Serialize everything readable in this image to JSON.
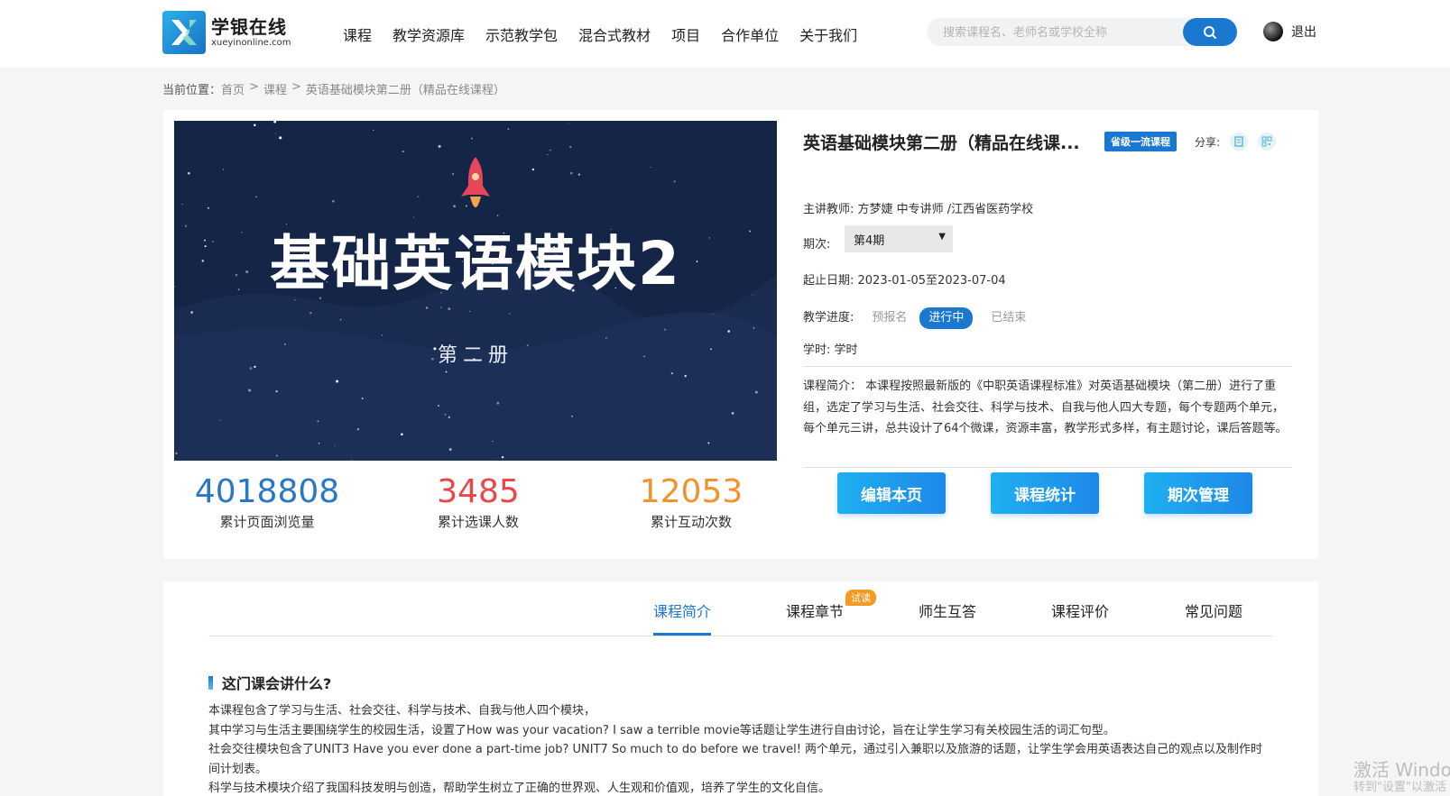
{
  "header": {
    "logo_cn": "学银在线",
    "logo_en": "xueyinonline.com",
    "nav": [
      "课程",
      "教学资源库",
      "示范教学包",
      "混合式教材",
      "项目",
      "合作单位",
      "关于我们"
    ],
    "search_placeholder": "搜索课程名、老师名或学校全称",
    "logout": "退出"
  },
  "breadcrumb": {
    "label": "当前位置：",
    "items": [
      "首页",
      "课程",
      "英语基础模块第二册（精品在线课程）"
    ],
    "separator": ">"
  },
  "course": {
    "cover_title": "基础英语模块2",
    "cover_subtitle": "第二册",
    "title": "英语基础模块第二册（精品在线课程）",
    "title_display": "英语基础模块第二册（精品在线课...",
    "badge": "省级一流课程",
    "share_label": "分享:",
    "teacher": "主讲教师: 方梦婕 中专讲师 /江西省医药学校",
    "term_label": "期次:",
    "term_value": "第4期",
    "dates": "起止日期: 2023-01-05至2023-07-04",
    "progress_label": "教学进度:",
    "stages": [
      "预报名",
      "进行中",
      "已结束"
    ],
    "hours": "学时: 学时",
    "intro": "课程简介：  本课程按照最新版的《中职英语课程标准》对英语基础模块（第二册）进行了重组，选定了学习与生活、社会交往、科学与技术、自我与他人四大专题，每个专题两个单元，每个单元三讲，总共设计了64个微课，资源丰富，教学形式多样，有主题讨论，课后答题等。",
    "buttons": [
      "编辑本页",
      "课程统计",
      "期次管理"
    ]
  },
  "stats": [
    {
      "value": "4018808",
      "label": "累计页面浏览量",
      "color": "#2a77c4"
    },
    {
      "value": "3485",
      "label": "累计选课人数",
      "color": "#e8484a"
    },
    {
      "value": "12053",
      "label": "累计互动次数",
      "color": "#f2922a"
    }
  ],
  "tabs": {
    "items": [
      "课程简介",
      "课程章节",
      "师生互答",
      "课程评价",
      "常见问题"
    ],
    "trial_badge": "试读"
  },
  "section": {
    "title": "这门课会讲什么?",
    "lines": [
      "本课程包含了学习与生活、社会交往、科学与技术、自我与他人四个模块，",
      "其中学习与生活主要围绕学生的校园生活，设置了How was your vacation? I saw a terrible movie等话题让学生进行自由讨论，旨在让学生学习有关校园生活的词汇句型。",
      "社会交往模块包含了UNIT3 Have you ever done a part-time job? UNIT7 So much to do before we travel! 两个单元，通过引入兼职以及旅游的话题，让学生学会用英语表达自己的观点以及制作时间计划表。",
      "科学与技术模块介绍了我国科技发明与创造，帮助学生树立了正确的世界观、人生观和价值观，培养了学生的文化自信。"
    ]
  },
  "watermark": {
    "line1": "激活 Windo",
    "line2": "转到\"设置\"以激活"
  }
}
